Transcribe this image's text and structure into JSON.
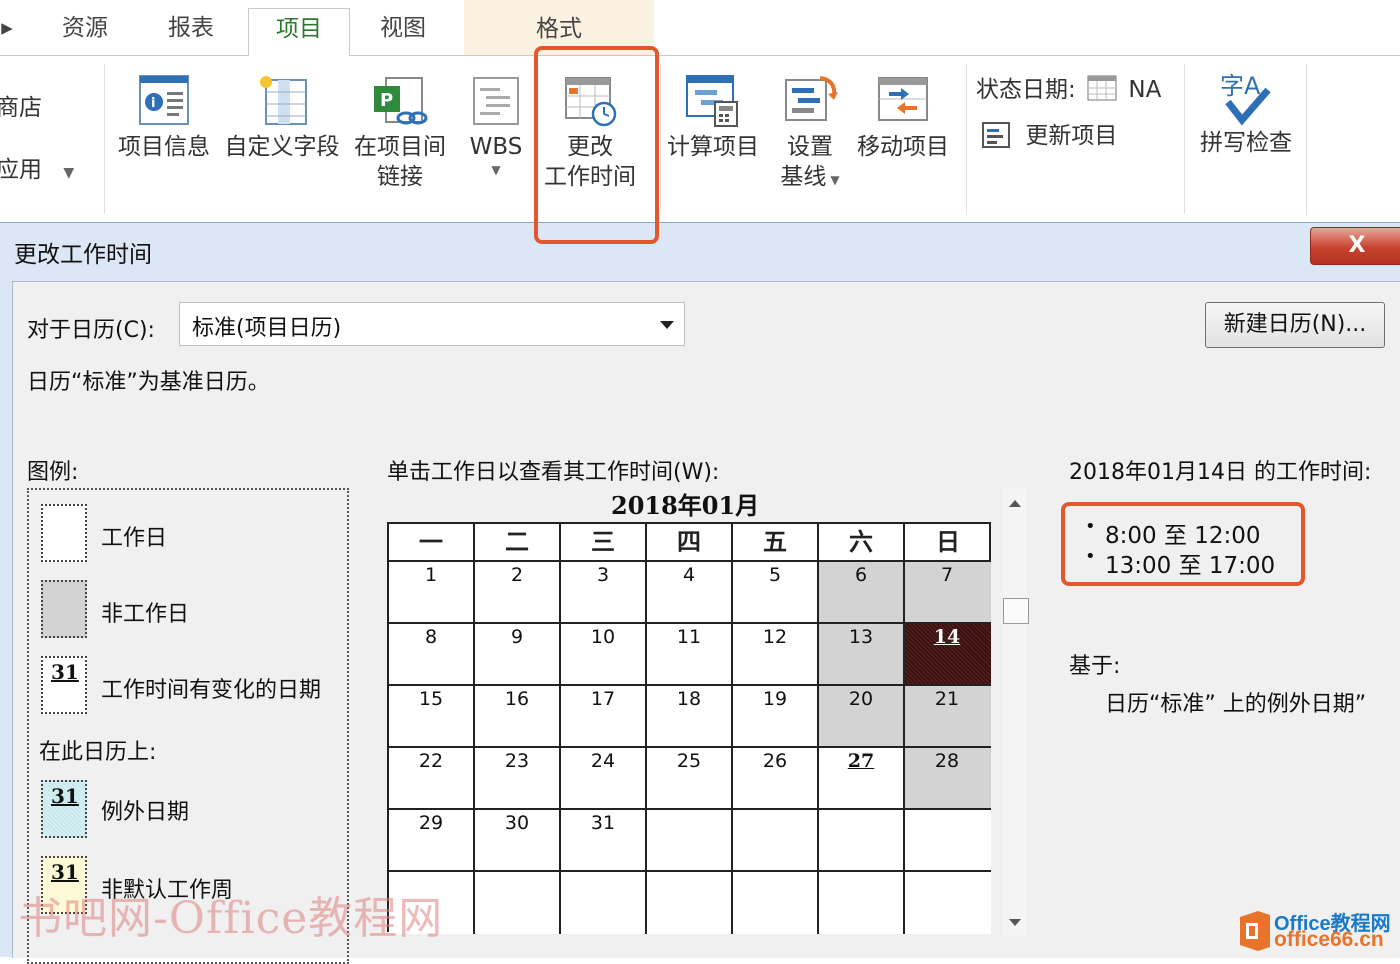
{
  "ribbon": {
    "tabs": [
      {
        "label": "资源"
      },
      {
        "label": "报表"
      },
      {
        "label": "项目",
        "active": true
      },
      {
        "label": "视图"
      },
      {
        "label": "格式"
      }
    ],
    "left_partial": {
      "store": "商店",
      "apps": "应用"
    },
    "buttons": {
      "project_info": "项目信息",
      "custom_fields": "自定义字段",
      "links_line1": "在项目间",
      "links_line2": "链接",
      "wbs": "WBS",
      "change_time_line1": "更改",
      "change_time_line2": "工作时间",
      "calc_project": "计算项目",
      "set_line1": "设置",
      "set_line2": "基线",
      "move_project": "移动项目",
      "status_date_label": "状态日期:",
      "status_date_value": "NA",
      "update_project": "更新项目",
      "spelling": "拼写检查"
    },
    "accent": "#e2572b"
  },
  "dialog": {
    "title": "更改工作时间",
    "close_label": "X",
    "for_calendar_label": "对于日历(C):",
    "calendar_value": "标准(项目日历)",
    "new_calendar_button": "新建日历(N)...",
    "base_info": "日历“标准”为基准日历。",
    "legend": {
      "title": "图例:",
      "working": "工作日",
      "nonworking": "非工作日",
      "edited": "工作时间有变化的日期",
      "on_this_calendar": "在此日历上:",
      "exception": "例外日期",
      "nondefault_week": "非默认工作周",
      "sample_day": "31"
    },
    "calendar": {
      "instruction": "单击工作日以查看其工作时间(W):",
      "month_title": "2018年01月",
      "weekdays": [
        "一",
        "二",
        "三",
        "四",
        "五",
        "六",
        "日"
      ],
      "weeks": [
        [
          "1",
          "2",
          "3",
          "4",
          "5",
          "6",
          "7"
        ],
        [
          "8",
          "9",
          "10",
          "11",
          "12",
          "13",
          "14"
        ],
        [
          "15",
          "16",
          "17",
          "18",
          "19",
          "20",
          "21"
        ],
        [
          "22",
          "23",
          "24",
          "25",
          "26",
          "27",
          "28"
        ],
        [
          "29",
          "30",
          "31",
          "",
          "",
          "",
          ""
        ],
        [
          "",
          "",
          "",
          "",
          "",
          "",
          ""
        ]
      ],
      "selected_day": "14",
      "exception_day": "27"
    },
    "working_times": {
      "heading": "2018年01月14日 的工作时间:",
      "items": [
        "8:00 至 12:00",
        "13:00 至 17:00"
      ],
      "based_on_label": "基于:",
      "based_on_value": "日历“标准” 上的例外日期”"
    }
  },
  "watermark": {
    "text": "书吧网-Office教程网",
    "logo_line1": "Office教程网",
    "logo_line2": "office66.cn"
  }
}
